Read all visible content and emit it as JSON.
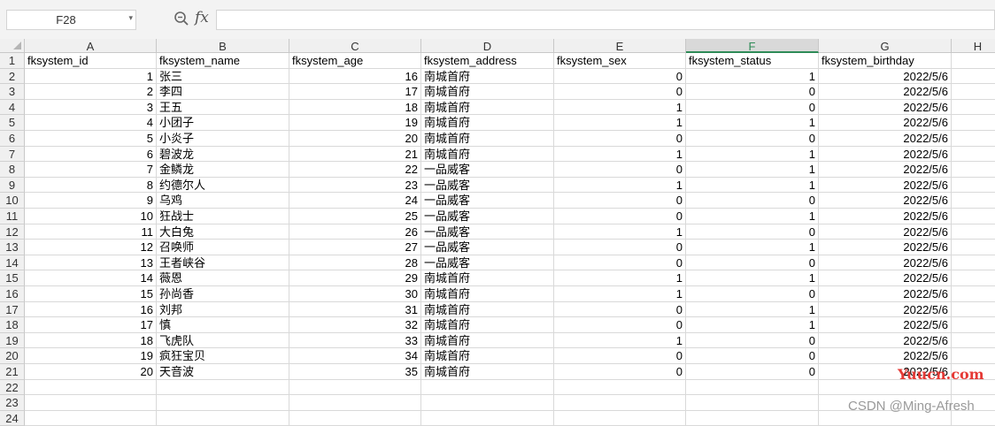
{
  "formula_bar": {
    "name_box": "F28",
    "fx_label": "fx",
    "formula": ""
  },
  "columns": [
    "A",
    "B",
    "C",
    "D",
    "E",
    "F",
    "G",
    "H"
  ],
  "active_column": "F",
  "row_numbers": [
    "1",
    "2",
    "3",
    "4",
    "5",
    "6",
    "7",
    "8",
    "9",
    "10",
    "11",
    "12",
    "13",
    "14",
    "15",
    "16",
    "17",
    "18",
    "19",
    "20",
    "21",
    "22",
    "23",
    "24"
  ],
  "headers": [
    "fksystem_id",
    "fksystem_name",
    "fksystem_age",
    "fksystem_address",
    "fksystem_sex",
    "fksystem_status",
    "fksystem_birthday"
  ],
  "rows": [
    [
      "1",
      "张三",
      "16",
      "南城首府",
      "0",
      "1",
      "2022/5/6"
    ],
    [
      "2",
      "李四",
      "17",
      "南城首府",
      "0",
      "0",
      "2022/5/6"
    ],
    [
      "3",
      "王五",
      "18",
      "南城首府",
      "1",
      "0",
      "2022/5/6"
    ],
    [
      "4",
      "小团子",
      "19",
      "南城首府",
      "1",
      "1",
      "2022/5/6"
    ],
    [
      "5",
      "小炎子",
      "20",
      "南城首府",
      "0",
      "0",
      "2022/5/6"
    ],
    [
      "6",
      "碧波龙",
      "21",
      "南城首府",
      "1",
      "1",
      "2022/5/6"
    ],
    [
      "7",
      "金鳞龙",
      "22",
      "一品威客",
      "0",
      "1",
      "2022/5/6"
    ],
    [
      "8",
      "约德尔人",
      "23",
      "一品威客",
      "1",
      "1",
      "2022/5/6"
    ],
    [
      "9",
      "乌鸡",
      "24",
      "一品威客",
      "0",
      "0",
      "2022/5/6"
    ],
    [
      "10",
      "狂战士",
      "25",
      "一品威客",
      "0",
      "1",
      "2022/5/6"
    ],
    [
      "11",
      "大白兔",
      "26",
      "一品威客",
      "1",
      "0",
      "2022/5/6"
    ],
    [
      "12",
      "召唤师",
      "27",
      "一品威客",
      "0",
      "1",
      "2022/5/6"
    ],
    [
      "13",
      "王者峡谷",
      "28",
      "一品威客",
      "0",
      "0",
      "2022/5/6"
    ],
    [
      "14",
      "薇恩",
      "29",
      "南城首府",
      "1",
      "1",
      "2022/5/6"
    ],
    [
      "15",
      "孙尚香",
      "30",
      "南城首府",
      "1",
      "0",
      "2022/5/6"
    ],
    [
      "16",
      "刘邦",
      "31",
      "南城首府",
      "0",
      "1",
      "2022/5/6"
    ],
    [
      "17",
      "慎",
      "32",
      "南城首府",
      "0",
      "1",
      "2022/5/6"
    ],
    [
      "18",
      "飞虎队",
      "33",
      "南城首府",
      "1",
      "0",
      "2022/5/6"
    ],
    [
      "19",
      "疯狂宝贝",
      "34",
      "南城首府",
      "0",
      "0",
      "2022/5/6"
    ],
    [
      "20",
      "天音波",
      "35",
      "南城首府",
      "0",
      "0",
      "2022/5/6"
    ]
  ],
  "watermarks": {
    "site": "Yuucn.com",
    "credit": "CSDN @Ming-Afresh"
  },
  "colors": {
    "active_col": "#2e8b57",
    "watermark_site": "#e53935"
  }
}
